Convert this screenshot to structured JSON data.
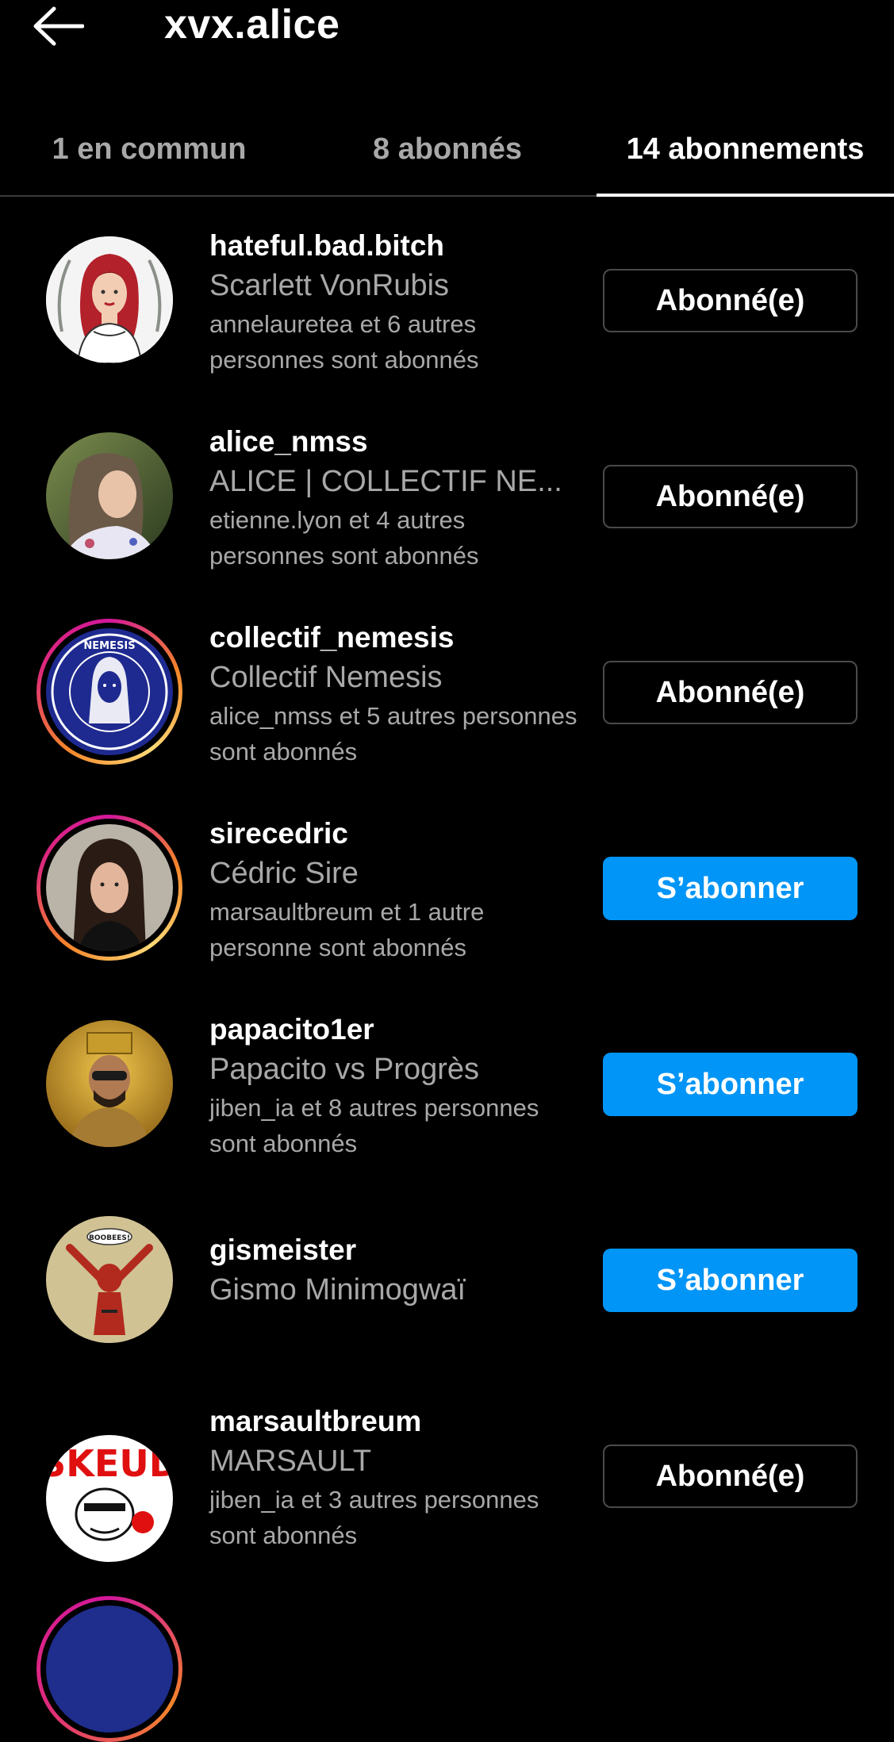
{
  "header": {
    "title": "xvx.alice"
  },
  "tabs": [
    {
      "label": "1 en commun",
      "active": false
    },
    {
      "label": "8 abonnés",
      "active": false
    },
    {
      "label": "14 abonnements",
      "active": true
    }
  ],
  "accounts": [
    {
      "username": "hateful.bad.bitch",
      "fullname": "Scarlett VonRubis",
      "mutual": "annelauretea et 6 autres personnes sont abonnés",
      "button": "Abonné(e)",
      "following": true,
      "story_ring": false
    },
    {
      "username": "alice_nmss",
      "fullname": "ALICE | COLLECTIF NE...",
      "mutual": "etienne.lyon et 4 autres personnes sont abonnés",
      "button": "Abonné(e)",
      "following": true,
      "story_ring": false
    },
    {
      "username": "collectif_nemesis",
      "fullname": "Collectif Nemesis",
      "mutual": "alice_nmss et 5 autres personnes sont abonnés",
      "button": "Abonné(e)",
      "following": true,
      "story_ring": true,
      "avatar_text": "NEMESIS"
    },
    {
      "username": "sirecedric",
      "fullname": "Cédric Sire",
      "mutual": "marsaultbreum et 1 autre personne sont abonnés",
      "button": "S’abonner",
      "following": false,
      "story_ring": true
    },
    {
      "username": "papacito1er",
      "fullname": "Papacito vs Progrès",
      "mutual": "jiben_ia et 8 autres personnes sont abonnés",
      "button": "S’abonner",
      "following": false,
      "story_ring": false
    },
    {
      "username": "gismeister",
      "fullname": "Gismo Minimogwaï",
      "mutual": "",
      "button": "S’abonner",
      "following": false,
      "story_ring": false,
      "avatar_text": "BOOBEES!"
    },
    {
      "username": "marsaultbreum",
      "fullname": "MARSAULT",
      "mutual": "jiben_ia et 3 autres personnes sont abonnés",
      "button": "Abonné(e)",
      "following": true,
      "story_ring": false,
      "avatar_text": "SKEUD"
    }
  ],
  "colors": {
    "background": "#000000",
    "primary_text": "#ffffff",
    "secondary_text": "#a8a8a8",
    "follow_button": "#0095f6",
    "following_border": "#4a4a4a"
  },
  "icons": {
    "back": "arrow-left-icon"
  }
}
